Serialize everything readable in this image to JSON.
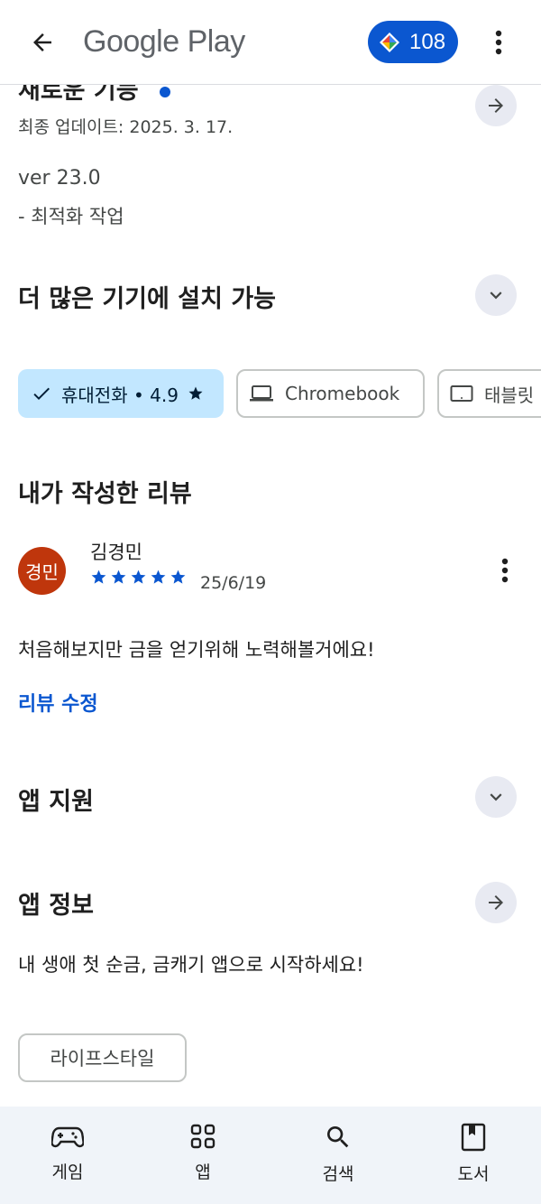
{
  "header": {
    "brand": "Google Play",
    "points": "108"
  },
  "whats_new": {
    "title": "새로운 기능",
    "updated": "최종 업데이트: 2025. 3. 17.",
    "version": "ver 23.0",
    "notes": "- 최적화 작업"
  },
  "devices": {
    "title": "더 많은 기기에 설치 가능",
    "chips": [
      {
        "label": "휴대전화 • 4.9",
        "icon": "check-icon",
        "selected": true
      },
      {
        "label": "Chromebook",
        "icon": "laptop-icon",
        "selected": false
      },
      {
        "label": "태블릿",
        "icon": "tablet-icon",
        "selected": false
      }
    ]
  },
  "my_review": {
    "title": "내가 작성한 리뷰",
    "avatar_text": "경민",
    "reviewer": "김경민",
    "rating": 5,
    "date": "25/6/19",
    "text": "처음해보지만 금을 얻기위해 노력해볼거에요!",
    "edit_label": "리뷰 수정"
  },
  "support": {
    "title": "앱 지원"
  },
  "about": {
    "title": "앱 정보",
    "description": "내 생애 첫 순금, 금캐기 앱으로 시작하세요!",
    "tag": "라이프스타일"
  },
  "bottom_nav": [
    {
      "label": "게임",
      "icon": "gamepad-icon"
    },
    {
      "label": "앱",
      "icon": "apps-grid-icon"
    },
    {
      "label": "검색",
      "icon": "search-icon"
    },
    {
      "label": "도서",
      "icon": "book-icon"
    }
  ],
  "colors": {
    "accent": "#0b57d0",
    "chip_selected": "#c2e7ff",
    "avatar": "#bf360c",
    "nav_bg": "#f0f4f9"
  }
}
